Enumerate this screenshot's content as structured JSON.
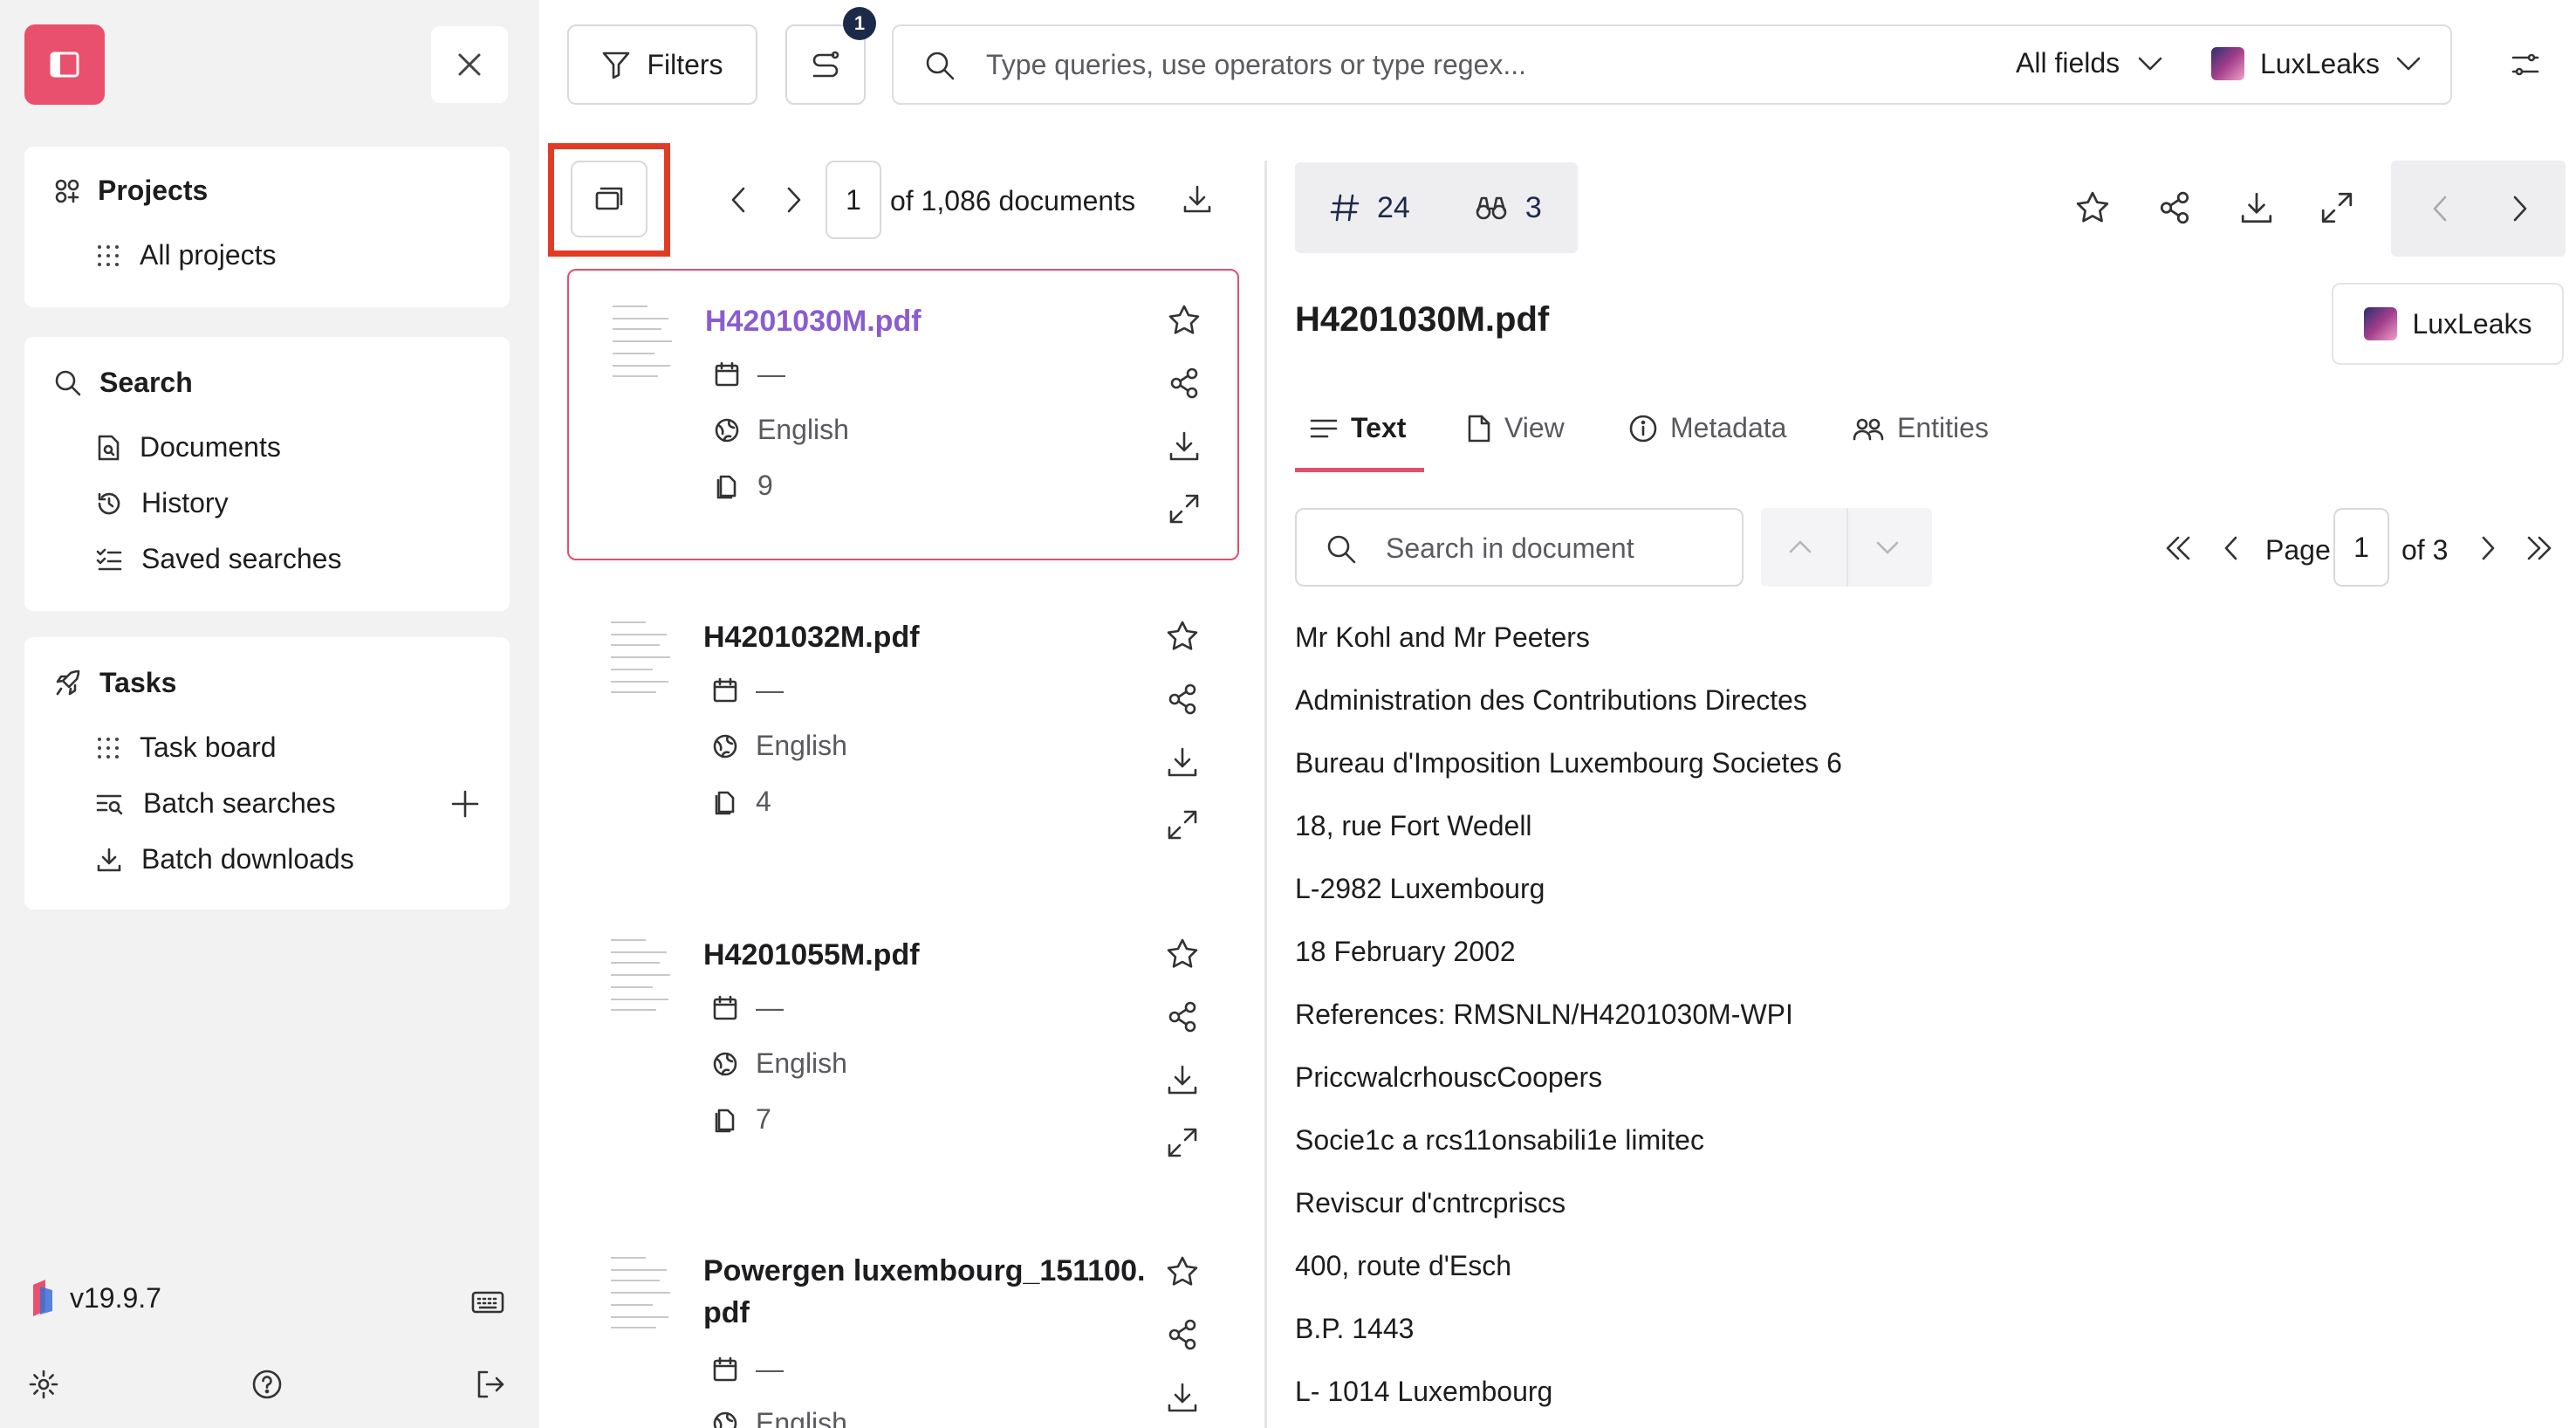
{
  "sidebar": {
    "projects": {
      "title": "Projects",
      "items": [
        {
          "label": "All projects"
        }
      ]
    },
    "search": {
      "title": "Search",
      "items": [
        {
          "label": "Documents"
        },
        {
          "label": "History"
        },
        {
          "label": "Saved searches"
        }
      ]
    },
    "tasks": {
      "title": "Tasks",
      "items": [
        {
          "label": "Task board"
        },
        {
          "label": "Batch searches"
        },
        {
          "label": "Batch downloads"
        }
      ]
    },
    "version": "v19.9.7"
  },
  "toolbar": {
    "filters_label": "Filters",
    "batch_badge": "1",
    "search_placeholder": "Type queries, use operators or type regex...",
    "field_select": "All fields",
    "project_select": "LuxLeaks"
  },
  "list": {
    "page": "1",
    "of_label": "of 1,086 documents",
    "documents": [
      {
        "title": "H4201030M.pdf",
        "date": "—",
        "language": "English",
        "pages": "9",
        "selected": true
      },
      {
        "title": "H4201032M.pdf",
        "date": "—",
        "language": "English",
        "pages": "4",
        "selected": false
      },
      {
        "title": "H4201055M.pdf",
        "date": "—",
        "language": "English",
        "pages": "7",
        "selected": false
      },
      {
        "title": "Powergen luxembourg_151100.pdf",
        "date": "—",
        "language": "English",
        "pages": "",
        "selected": false
      }
    ]
  },
  "detail": {
    "id_count": "24",
    "entity_count": "3",
    "title": "H4201030M.pdf",
    "project": "LuxLeaks",
    "tabs": [
      {
        "label": "Text"
      },
      {
        "label": "View"
      },
      {
        "label": "Metadata"
      },
      {
        "label": "Entities"
      }
    ],
    "search_placeholder": "Search in document",
    "page_label": "Page",
    "page": "1",
    "of_pages": "of 3",
    "text_lines": [
      "Mr Kohl and Mr Peeters",
      "Administration des Contributions Directes",
      "Bureau d'Imposition Luxembourg Societes 6",
      "18, rue Fort Wedell",
      "L-2982 Luxembourg",
      "18 February 2002",
      "References: RMSNLN/H4201030M-WPI",
      "PriccwalcrhouscCoopers",
      "Socie1c a rcs11onsabili1e limitec",
      "Reviscur d'cntrcpriscs",
      "400, route d'Esch",
      "B.P. 1443",
      "L- 1014 Luxembourg"
    ]
  },
  "colors": {
    "accent": "#e8506e",
    "selected_title": "#8a5cd0",
    "highlight": "#e23b25",
    "navy": "#1c2a4a"
  }
}
